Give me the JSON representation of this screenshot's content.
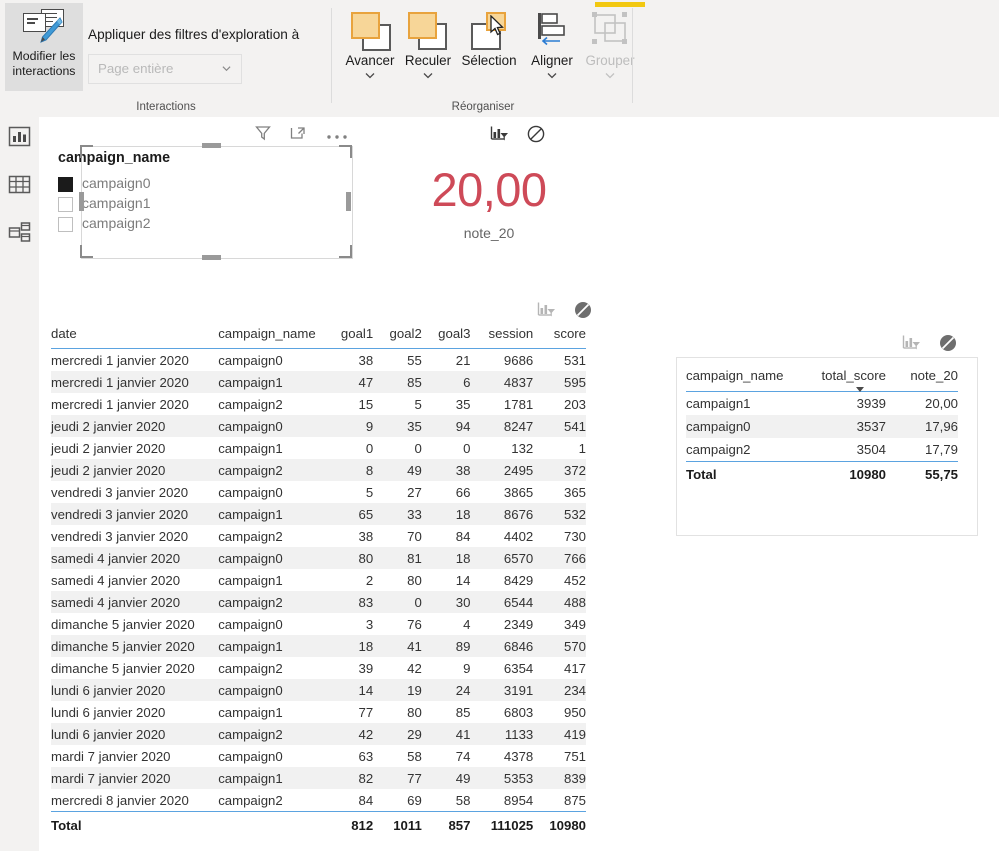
{
  "ribbon": {
    "accent_color": "#f2c811",
    "interactions": {
      "edit_button_line1": "Modifier les",
      "edit_button_line2": "interactions",
      "apply_label": "Appliquer des filtres d'exploration à",
      "scope_value": "Page entière",
      "group_label": "Interactions"
    },
    "reorganize": {
      "group_label": "Réorganiser",
      "buttons": [
        {
          "label": "Avancer",
          "disabled": false,
          "has_chevron": true
        },
        {
          "label": "Reculer",
          "disabled": false,
          "has_chevron": true
        },
        {
          "label": "Sélection",
          "disabled": false,
          "has_chevron": false
        },
        {
          "label": "Aligner",
          "disabled": false,
          "has_chevron": true
        },
        {
          "label": "Grouper",
          "disabled": true,
          "has_chevron": true
        }
      ]
    }
  },
  "leftnav": {
    "items": [
      {
        "icon": "report-bar-chart-icon",
        "name": "report-view"
      },
      {
        "icon": "data-table-icon",
        "name": "data-view"
      },
      {
        "icon": "model-relationships-icon",
        "name": "model-view"
      }
    ]
  },
  "slicer": {
    "title": "campaign_name",
    "header_icons": [
      "filter-icon",
      "focus-mode-icon",
      "more-options-icon"
    ],
    "items": [
      {
        "label": "campaign0",
        "selected": true
      },
      {
        "label": "campaign1",
        "selected": false
      },
      {
        "label": "campaign2",
        "selected": false
      }
    ]
  },
  "card": {
    "value": "20,00",
    "label": "note_20",
    "value_color": "#ce4a58",
    "header_icons": [
      "chart-filter-icon",
      "no-interaction-icon"
    ],
    "chart_filter_active": true,
    "no_interaction_active": false
  },
  "main_table": {
    "header_icons": [
      "chart-filter-icon",
      "no-interaction-icon"
    ],
    "chart_filter_active": false,
    "no_interaction_active": true,
    "columns": [
      "date",
      "campaign_name",
      "goal1",
      "goal2",
      "goal3",
      "session",
      "score"
    ],
    "rows": [
      [
        "mercredi 1 janvier 2020",
        "campaign0",
        "38",
        "55",
        "21",
        "9686",
        "531"
      ],
      [
        "mercredi 1 janvier 2020",
        "campaign1",
        "47",
        "85",
        "6",
        "4837",
        "595"
      ],
      [
        "mercredi 1 janvier 2020",
        "campaign2",
        "15",
        "5",
        "35",
        "1781",
        "203"
      ],
      [
        "jeudi 2 janvier 2020",
        "campaign0",
        "9",
        "35",
        "94",
        "8247",
        "541"
      ],
      [
        "jeudi 2 janvier 2020",
        "campaign1",
        "0",
        "0",
        "0",
        "132",
        "1"
      ],
      [
        "jeudi 2 janvier 2020",
        "campaign2",
        "8",
        "49",
        "38",
        "2495",
        "372"
      ],
      [
        "vendredi 3 janvier 2020",
        "campaign0",
        "5",
        "27",
        "66",
        "3865",
        "365"
      ],
      [
        "vendredi 3 janvier 2020",
        "campaign1",
        "65",
        "33",
        "18",
        "8676",
        "532"
      ],
      [
        "vendredi 3 janvier 2020",
        "campaign2",
        "38",
        "70",
        "84",
        "4402",
        "730"
      ],
      [
        "samedi 4 janvier 2020",
        "campaign0",
        "80",
        "81",
        "18",
        "6570",
        "766"
      ],
      [
        "samedi 4 janvier 2020",
        "campaign1",
        "2",
        "80",
        "14",
        "8429",
        "452"
      ],
      [
        "samedi 4 janvier 2020",
        "campaign2",
        "83",
        "0",
        "30",
        "6544",
        "488"
      ],
      [
        "dimanche 5 janvier 2020",
        "campaign0",
        "3",
        "76",
        "4",
        "2349",
        "349"
      ],
      [
        "dimanche 5 janvier 2020",
        "campaign1",
        "18",
        "41",
        "89",
        "6846",
        "570"
      ],
      [
        "dimanche 5 janvier 2020",
        "campaign2",
        "39",
        "42",
        "9",
        "6354",
        "417"
      ],
      [
        "lundi 6 janvier 2020",
        "campaign0",
        "14",
        "19",
        "24",
        "3191",
        "234"
      ],
      [
        "lundi 6 janvier 2020",
        "campaign1",
        "77",
        "80",
        "85",
        "6803",
        "950"
      ],
      [
        "lundi 6 janvier 2020",
        "campaign2",
        "42",
        "29",
        "41",
        "1133",
        "419"
      ],
      [
        "mardi 7 janvier 2020",
        "campaign0",
        "63",
        "58",
        "74",
        "4378",
        "751"
      ],
      [
        "mardi 7 janvier 2020",
        "campaign1",
        "82",
        "77",
        "49",
        "5353",
        "839"
      ],
      [
        "mercredi 8 janvier 2020",
        "campaign2",
        "84",
        "69",
        "58",
        "8954",
        "875"
      ]
    ],
    "total_row": [
      "Total",
      "",
      "812",
      "1011",
      "857",
      "111025",
      "10980"
    ]
  },
  "summary_table": {
    "header_icons": [
      "chart-filter-icon",
      "no-interaction-icon"
    ],
    "chart_filter_active": false,
    "no_interaction_active": true,
    "columns": [
      "campaign_name",
      "total_score",
      "note_20"
    ],
    "sorted_column": "total_score",
    "sort_direction": "descending",
    "rows": [
      [
        "campaign1",
        "3939",
        "20,00"
      ],
      [
        "campaign0",
        "3537",
        "17,96"
      ],
      [
        "campaign2",
        "3504",
        "17,79"
      ]
    ],
    "total_row": [
      "Total",
      "10980",
      "55,75"
    ]
  }
}
